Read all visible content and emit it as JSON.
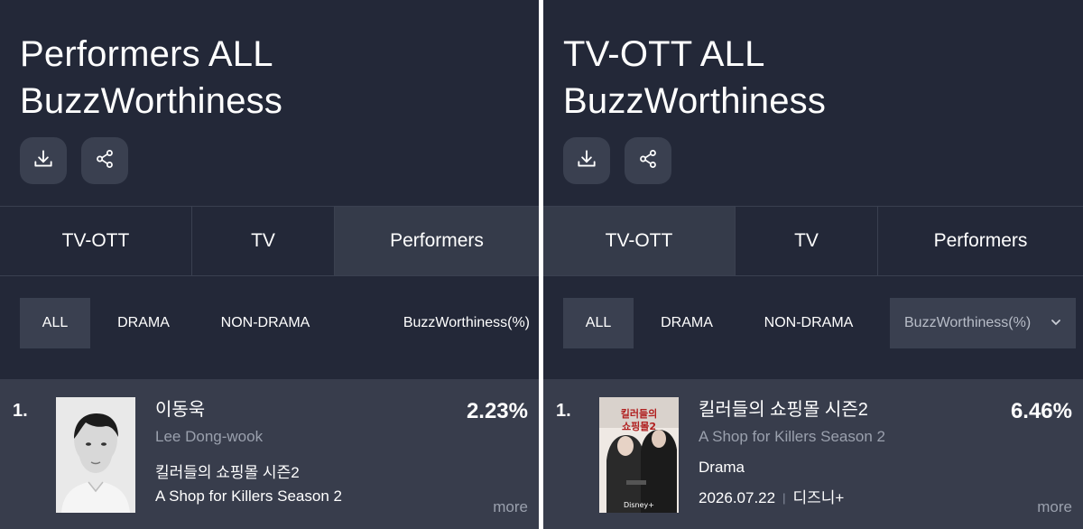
{
  "colors": {
    "panel_bg": "#232838",
    "button_bg": "#3a4050",
    "active_tab_bg": "#353b4a",
    "row_bg": "#383d4c",
    "muted_text": "#9aa0ad"
  },
  "left": {
    "title_line1": "Performers ALL",
    "title_line2": "BuzzWorthiness",
    "download_icon": "download-icon",
    "share_icon": "share-icon",
    "tabs": [
      "TV-OTT",
      "TV",
      "Performers"
    ],
    "active_tab": "Performers",
    "filters": [
      "ALL",
      "DRAMA",
      "NON-DRAMA"
    ],
    "metric": "BuzzWorthiness(%)",
    "item": {
      "rank": "1.",
      "name_ko": "이동욱",
      "name_en": "Lee Dong-wook",
      "work_ko": "킬러들의 쇼핑몰 시즌2",
      "work_en": "A Shop for Killers Season 2",
      "percent": "2.23%",
      "more": "more"
    }
  },
  "right": {
    "title_line1": "TV-OTT ALL",
    "title_line2": "BuzzWorthiness",
    "download_icon": "download-icon",
    "share_icon": "share-icon",
    "tabs": [
      "TV-OTT",
      "TV",
      "Performers"
    ],
    "active_tab": "TV-OTT",
    "filters": [
      "ALL",
      "DRAMA",
      "NON-DRAMA"
    ],
    "metric": "BuzzWorthiness(%)",
    "item": {
      "rank": "1.",
      "title_ko": "킬러들의 쇼핑몰 시즌2",
      "title_en": "A Shop for Killers Season 2",
      "genre": "Drama",
      "date": "2026.07.22",
      "platform": "디즈니+",
      "percent": "6.46%",
      "more": "more"
    }
  }
}
